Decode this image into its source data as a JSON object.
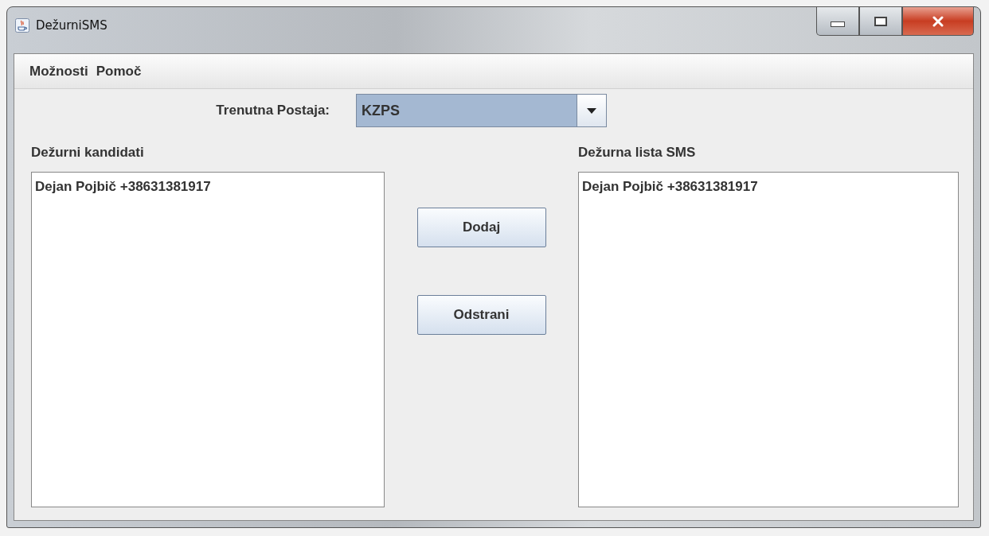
{
  "window": {
    "title": "DežurniSMS"
  },
  "menu": [
    "Možnosti",
    "Pomoč"
  ],
  "station": {
    "label": "Trenutna Postaja:",
    "value": "KZPS"
  },
  "candidates": {
    "title": "Dežurni kandidati",
    "items": [
      "Dejan Pojbič +38631381917"
    ]
  },
  "buttons": [
    "Dodaj",
    "Odstrani"
  ],
  "sms_list": {
    "title": "Dežurna lista SMS",
    "items": [
      "Dejan Pojbič +38631381917"
    ]
  }
}
